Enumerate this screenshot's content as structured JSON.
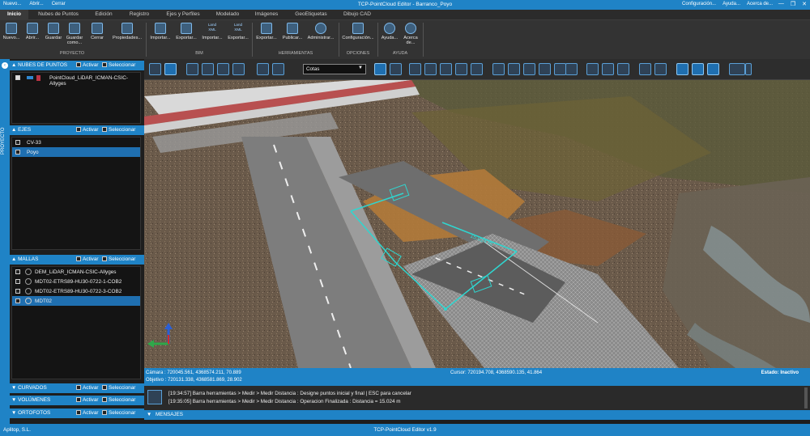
{
  "titlebar": {
    "quick": [
      "Nuevo...",
      "Abrir...",
      "Cerrar"
    ],
    "title": "TCP-PointCloud Editor - Barranco_Poyo",
    "right": [
      "Configuración...",
      "Ayuda...",
      "Acerca de..."
    ]
  },
  "tabs": [
    "Inicio",
    "Nubes de Puntos",
    "Edición",
    "Registro",
    "Ejes y Perfiles",
    "Modelado",
    "Imágenes",
    "GeoEtiquetas",
    "Dibujo CAD"
  ],
  "ribbon": {
    "buttons": [
      {
        "label": "Nuevo...",
        "icon": "new-folder-icon"
      },
      {
        "label": "Abrir...",
        "icon": "open-folder-icon"
      },
      {
        "label": "Guardar",
        "icon": "save-icon"
      },
      {
        "label": "Guardar como...",
        "icon": "save-as-icon"
      },
      {
        "label": "Cerrar",
        "icon": "close-project-icon"
      },
      {
        "label": "Propiedades...",
        "icon": "properties-icon"
      },
      {
        "label": "Importar...",
        "icon": "bim-import-icon"
      },
      {
        "label": "Exportar...",
        "icon": "bim-export-icon"
      },
      {
        "label": "Importar...",
        "icon": "landxml-import-icon",
        "tag": "Land XML"
      },
      {
        "label": "Exportar...",
        "icon": "landxml-export-icon",
        "tag": "Land XML"
      },
      {
        "label": "Exportar...",
        "icon": "pdf-export-icon"
      },
      {
        "label": "Publicar...",
        "icon": "publish-icon"
      },
      {
        "label": "Administrar...",
        "icon": "globe-icon"
      },
      {
        "label": "Configuración...",
        "icon": "settings-icon"
      },
      {
        "label": "Ayuda...",
        "icon": "help-icon"
      },
      {
        "label": "Acerca de...",
        "icon": "info-icon"
      }
    ],
    "groups": [
      "PROYECTO",
      "BIM",
      "HERRAMIENTAS",
      "OPCIONES",
      "AYUDA"
    ]
  },
  "toolbar": {
    "dropdown_value": "Cotas"
  },
  "sidebar_rail": {
    "label": "PROYECTO"
  },
  "panels": {
    "activar": "Activar",
    "seleccionar": "Seleccionar",
    "nubes": {
      "title": "NUBES DE PUNTOS",
      "items": [
        "PointCloud_LiDAR_ICMAN-CSIC-Allyges"
      ]
    },
    "ejes": {
      "title": "EJES",
      "items": [
        "CV-33",
        "Poyo"
      ]
    },
    "mallas": {
      "title": "MALLAS",
      "items": [
        "DEM_LiDAR_ICMAN-CSIC-Allyges",
        "MDT02-ETRS89-HU30-0722-1-COB2",
        "MDT02-ETRS89-HU30-0722-3-COB2",
        "MDT02"
      ]
    },
    "curvados": {
      "title": "CURVADOS"
    },
    "volumenes": {
      "title": "VOLÚMENES"
    },
    "ortofotos": {
      "title": "ORTOFOTOS"
    }
  },
  "measure_label": "15.024 m",
  "infobar": {
    "camara": "Cámara : 720045.561, 4368574.211, 70.889",
    "objetivo": "Objetivo : 720131.338, 4368581.869, 28.902",
    "cursor": "Cursor: 720194.708, 4368590.135, 41.864",
    "estado": "Estado: Inactivo"
  },
  "messages": [
    "[19:34:57] Barra herramientas > Medir > Medir Distancia : Designe puntos inicial y final | ESC para cancelar",
    "[19:35:05] Barra herramientas > Medir > Medir Distancia : Operacion Finalizada : Distancia = 15.024 m"
  ],
  "messages_header": "MENSAJES",
  "statusbar": {
    "company": "Aplitop, S.L.",
    "app": "TCP-PointCloud Editor v1.9"
  },
  "colors": {
    "accent": "#1f83c6",
    "measure": "#2fd6d0"
  }
}
